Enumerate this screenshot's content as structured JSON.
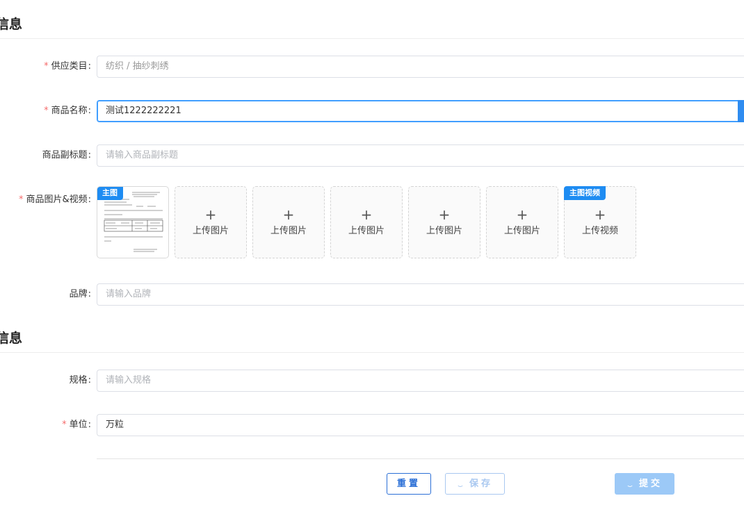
{
  "sections": [
    {
      "title": "信息"
    },
    {
      "title": "信息"
    }
  ],
  "form": {
    "category": {
      "label": "供应类目",
      "required": true,
      "value": "纺织 / 抽纱刺绣"
    },
    "name": {
      "label": "商品名称",
      "required": true,
      "value": "测试1222222221"
    },
    "subtitle": {
      "label": "商品副标题",
      "required": false,
      "placeholder": "请输入商品副标题"
    },
    "media": {
      "label": "商品图片&视频",
      "required": true,
      "main_badge": "主图",
      "upload_image_label": "上传图片",
      "video_badge": "主图视频",
      "upload_video_label": "上传视频",
      "plus": "+"
    },
    "brand": {
      "label": "品牌",
      "required": false,
      "placeholder": "请输入品牌"
    },
    "spec": {
      "label": "规格",
      "required": false,
      "placeholder": "请输入规格"
    },
    "unit": {
      "label": "单位",
      "required": true,
      "value": "万粒"
    }
  },
  "colon": ":",
  "required_mark": "*",
  "buttons": {
    "reset": "重置",
    "save": "保存",
    "submit": "提交"
  },
  "colors": {
    "primary": "#409eff",
    "badge": "#1e8cf2",
    "required": "#f56c6c"
  }
}
